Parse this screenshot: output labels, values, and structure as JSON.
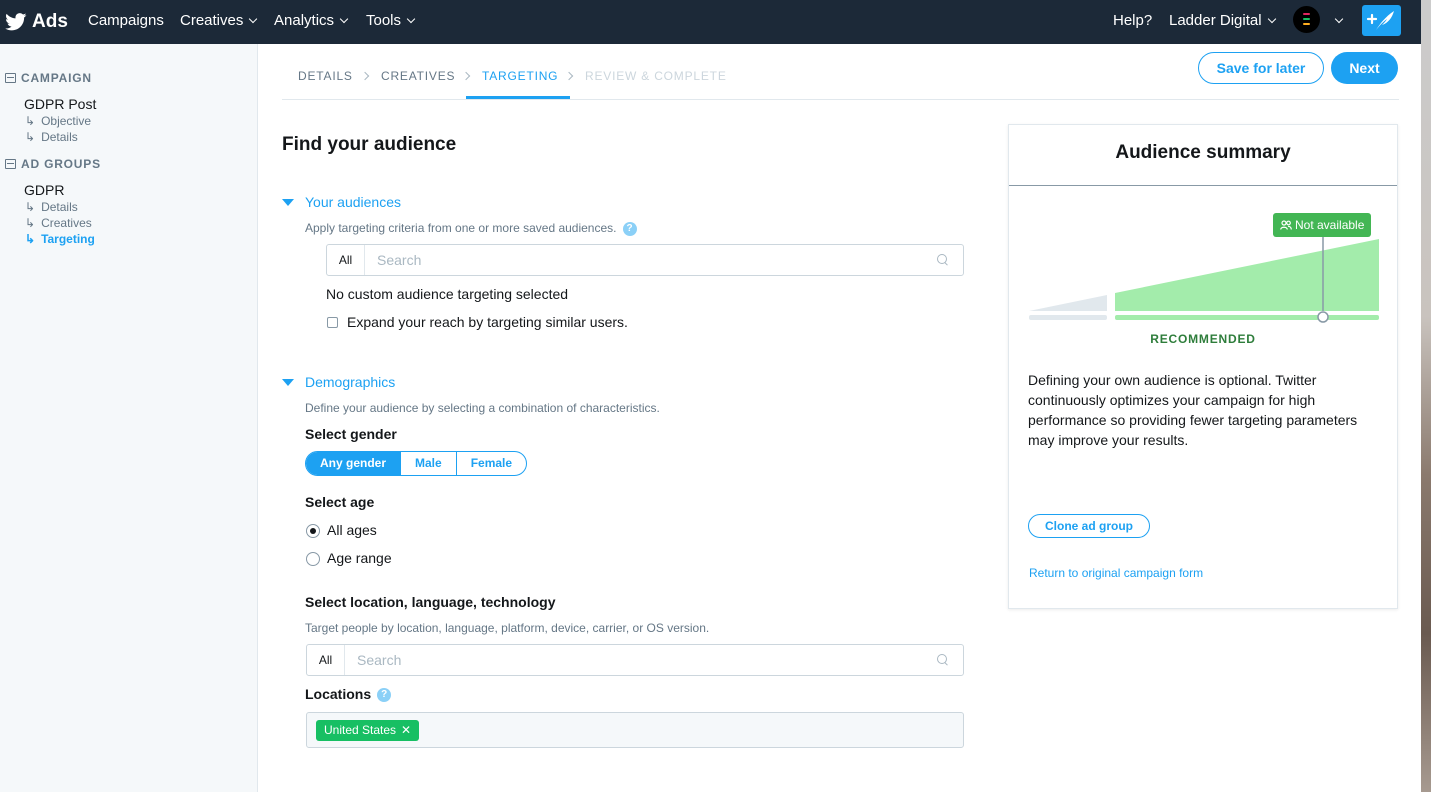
{
  "nav": {
    "brand": "Ads",
    "items": [
      {
        "label": "Campaigns",
        "dropdown": false
      },
      {
        "label": "Creatives",
        "dropdown": true
      },
      {
        "label": "Analytics",
        "dropdown": true
      },
      {
        "label": "Tools",
        "dropdown": true
      }
    ],
    "help": "Help?",
    "account": "Ladder Digital",
    "icons": [
      "twitter-bird-icon",
      "avatar",
      "compose-tweet-icon"
    ]
  },
  "sidebar": {
    "campaign_heading": "CAMPAIGN",
    "campaign_name": "GDPR Post",
    "campaign_items": [
      "Objective",
      "Details"
    ],
    "adgroups_heading": "AD GROUPS",
    "adgroup_name": "GDPR",
    "adgroup_items": [
      "Details",
      "Creatives",
      "Targeting"
    ],
    "active_item": "Targeting",
    "arrow": "↳"
  },
  "steps": {
    "items": [
      "DETAILS",
      "CREATIVES",
      "TARGETING",
      "REVIEW & COMPLETE"
    ],
    "active": "TARGETING",
    "save_label": "Save for later",
    "next_label": "Next"
  },
  "main": {
    "title": "Find your audience",
    "your_audiences": {
      "title": "Your audiences",
      "description": "Apply targeting criteria from one or more saved audiences.",
      "help": "?",
      "filter": "All",
      "placeholder": "Search",
      "status": "No custom audience targeting selected",
      "expand_label": "Expand your reach by targeting similar users.",
      "expand_checked": false
    },
    "demographics": {
      "title": "Demographics",
      "description": "Define your audience by selecting a combination of characteristics.",
      "gender_label": "Select gender",
      "gender_options": [
        "Any gender",
        "Male",
        "Female"
      ],
      "gender_selected": "Any gender",
      "age_label": "Select age",
      "age_options": [
        "All ages",
        "Age range"
      ],
      "age_selected": "All ages",
      "location_label": "Select location, language, technology",
      "location_description": "Target people by location, language, platform, device, carrier, or OS version.",
      "location_filter": "All",
      "location_placeholder": "Search",
      "locations_label": "Locations",
      "locations_help": "?",
      "locations": [
        "United States"
      ],
      "remove_glyph": "✕"
    }
  },
  "summary": {
    "title": "Audience summary",
    "badge": "Not available",
    "recommended": "RECOMMENDED",
    "text": "Defining your own audience is optional. Twitter continuously optimizes your campaign for high performance so providing fewer targeting parameters may improve your results.",
    "clone_label": "Clone ad group",
    "return_label": "Return to original campaign form"
  },
  "colors": {
    "nav_bg": "#1c2938",
    "accent": "#1da1f2",
    "green": "#17bf63",
    "recommended_fill": "#a3ecab",
    "recommended_text": "#2e7d3b"
  }
}
